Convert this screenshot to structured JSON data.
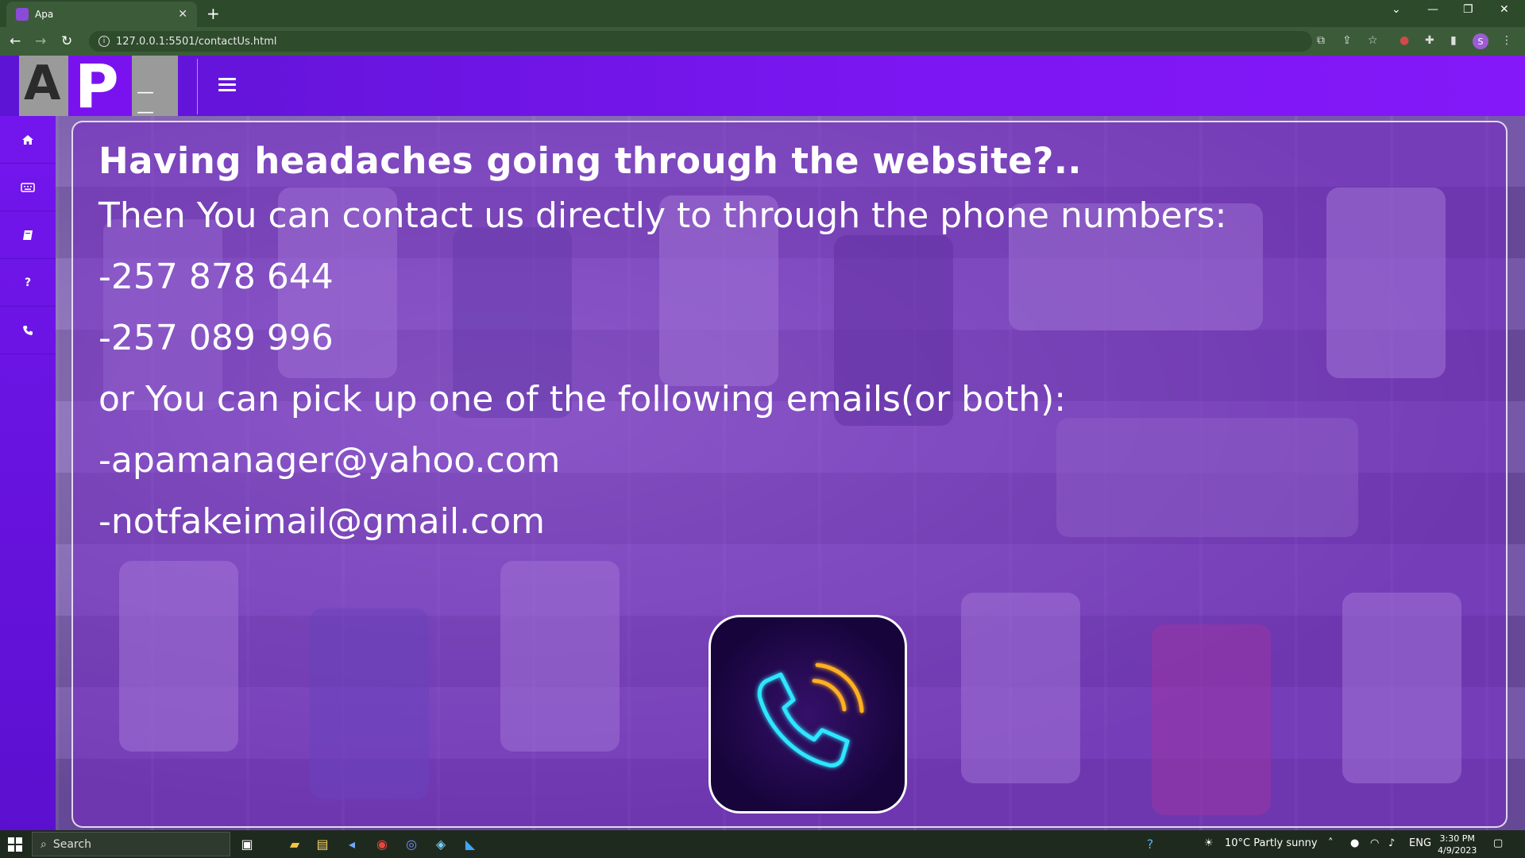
{
  "browser": {
    "tab_title": "Apa",
    "new_tab_label": "+",
    "url": "127.0.0.1:5501/contactUs.html"
  },
  "header": {
    "logo_letter_a": "A",
    "logo_letter_p": "P"
  },
  "sidebar": {
    "items": [
      {
        "name": "home",
        "icon": "home-icon"
      },
      {
        "name": "keyboard",
        "icon": "keyboard-icon"
      },
      {
        "name": "book",
        "icon": "book-icon"
      },
      {
        "name": "help",
        "icon": "question-icon"
      },
      {
        "name": "contact",
        "icon": "phone-icon"
      }
    ]
  },
  "main": {
    "heading": "Having headaches going through the website?..",
    "intro": "Then You can contact us directly to through the phone numbers:",
    "phones": [
      "-257 878 644",
      "-257 089 996"
    ],
    "email_intro": "or You can pick up one of the following emails(or both):",
    "emails": [
      "-apamanager@yahoo.com",
      "-notfakeimail@gmail.com"
    ]
  },
  "taskbar": {
    "search_placeholder": "Search",
    "weather": "10°C  Partly sunny",
    "language": "ENG",
    "time": "3:30 PM",
    "date": "4/9/2023"
  },
  "colors": {
    "nav_purple": "#7c16f2",
    "panel_overlay": "#7428c4",
    "neon_cyan": "#2ee6ff",
    "neon_yellow": "#ffb020"
  }
}
